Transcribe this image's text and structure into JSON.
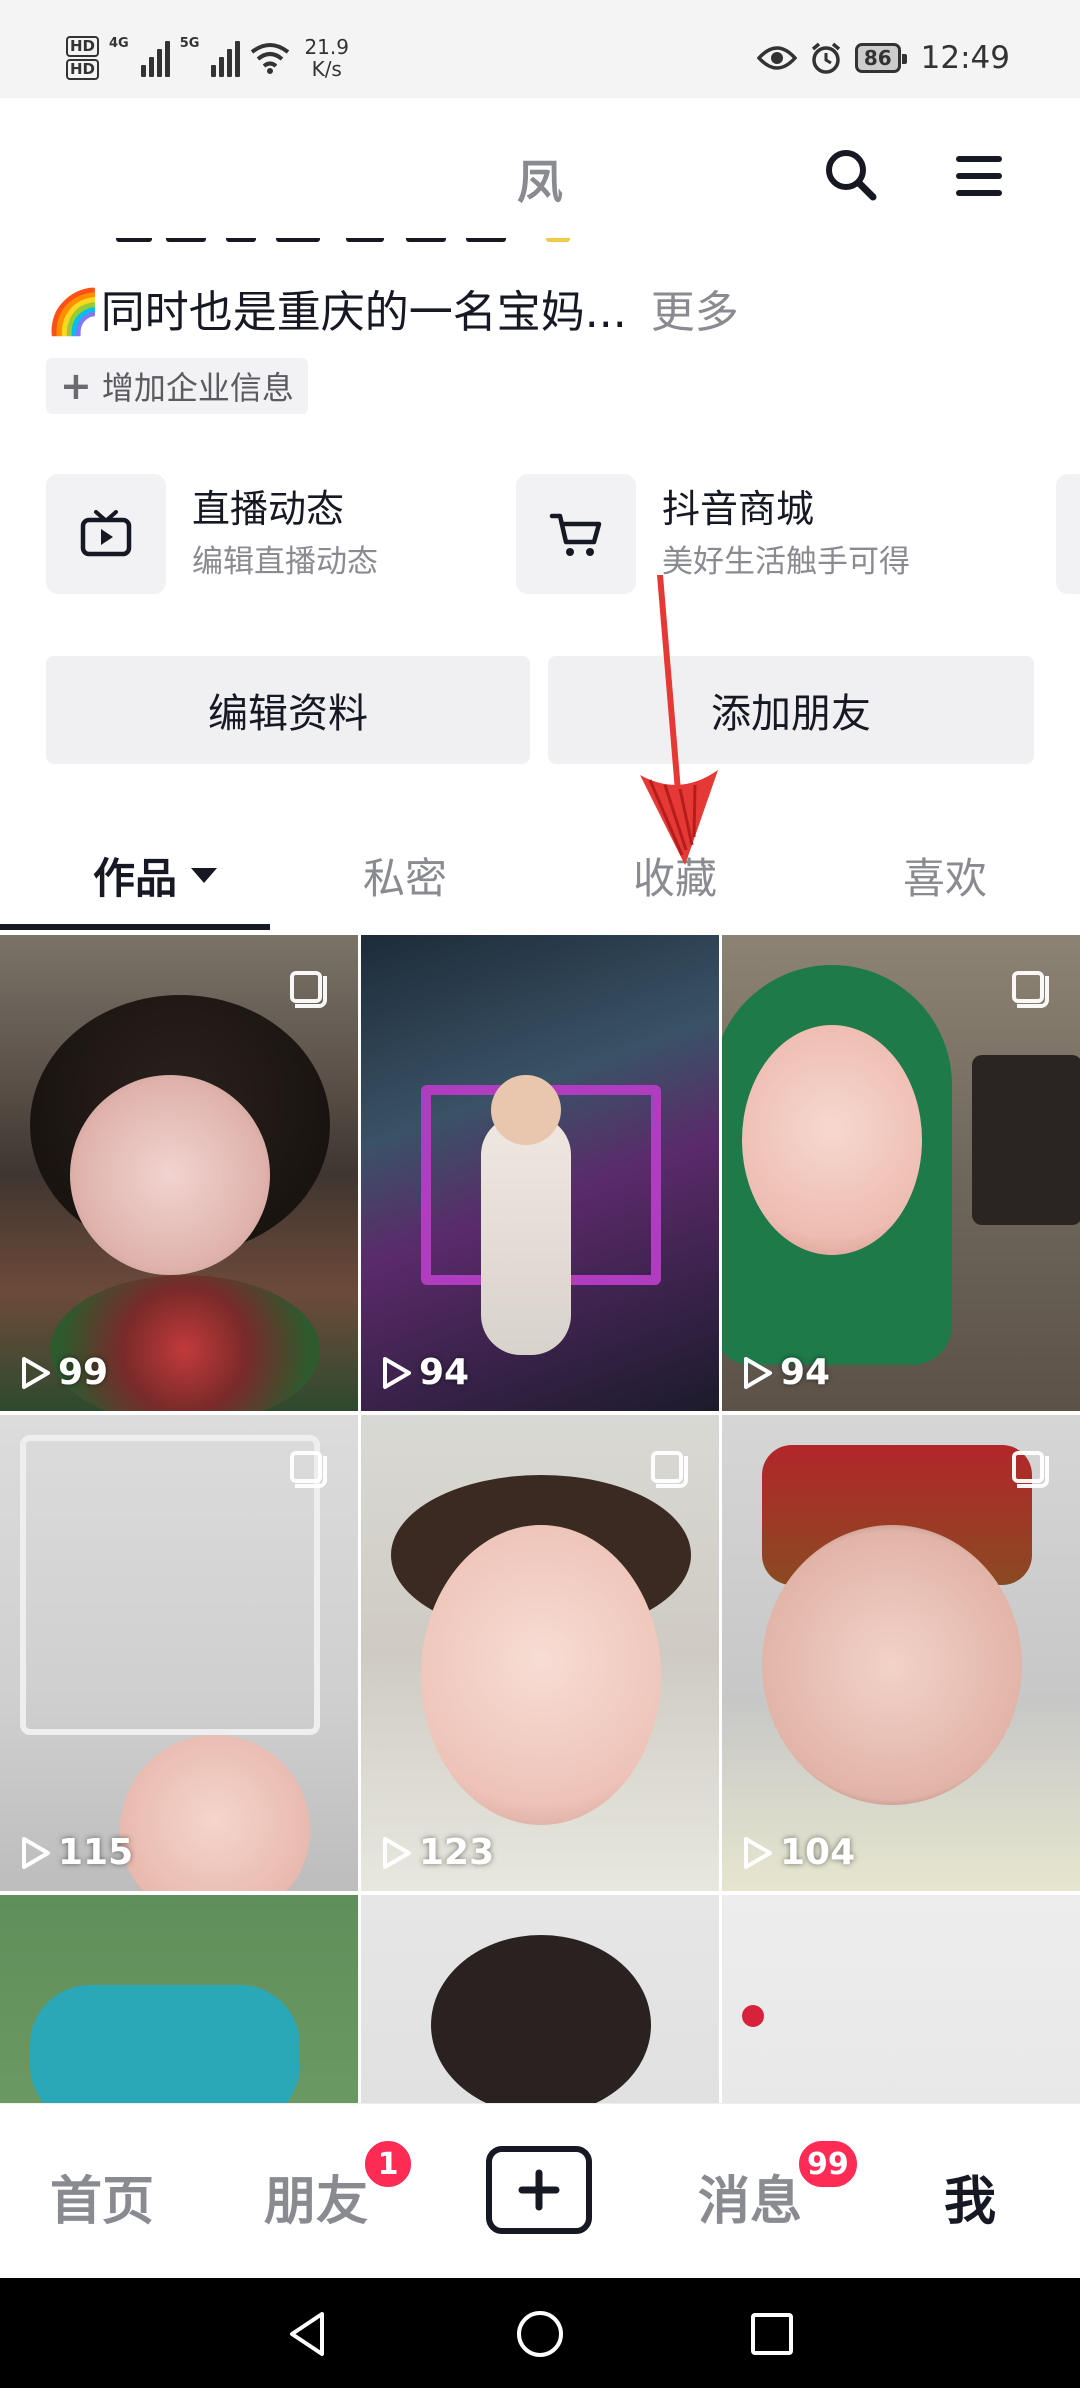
{
  "status_bar": {
    "hd_labels": [
      "HD",
      "HD"
    ],
    "network_1": "4G",
    "network_2": "5G",
    "speed_value": "21.9",
    "speed_unit": "K/s",
    "battery": "86",
    "time": "12:49"
  },
  "header": {
    "title": "凤"
  },
  "profile": {
    "bio_text": "🌈同时也是重庆的一名宝妈...",
    "bio_more": "更多",
    "add_enterprise": "增加企业信息"
  },
  "features": [
    {
      "title": "直播动态",
      "subtitle": "编辑直播动态",
      "icon": "tv-icon"
    },
    {
      "title": "抖音商城",
      "subtitle": "美好生活触手可得",
      "icon": "cart-icon"
    }
  ],
  "actions": {
    "edit_profile": "编辑资料",
    "add_friend": "添加朋友"
  },
  "tabs": [
    {
      "label": "作品",
      "active": true
    },
    {
      "label": "私密",
      "active": false
    },
    {
      "label": "收藏",
      "active": false
    },
    {
      "label": "喜欢",
      "active": false
    }
  ],
  "videos": [
    {
      "plays": "99"
    },
    {
      "plays": "94"
    },
    {
      "plays": "94"
    },
    {
      "plays": "115"
    },
    {
      "plays": "123"
    },
    {
      "plays": "104"
    },
    {
      "plays": ""
    },
    {
      "plays": ""
    },
    {
      "plays": ""
    }
  ],
  "bottom_nav": {
    "home": "首页",
    "friends": "朋友",
    "friends_badge": "1",
    "messages": "消息",
    "messages_badge": "99",
    "me": "我"
  },
  "colors": {
    "accent_red": "#fe2c55",
    "text_primary": "#161823",
    "text_secondary": "#8a8b91",
    "annotation_arrow": "#e53935"
  }
}
